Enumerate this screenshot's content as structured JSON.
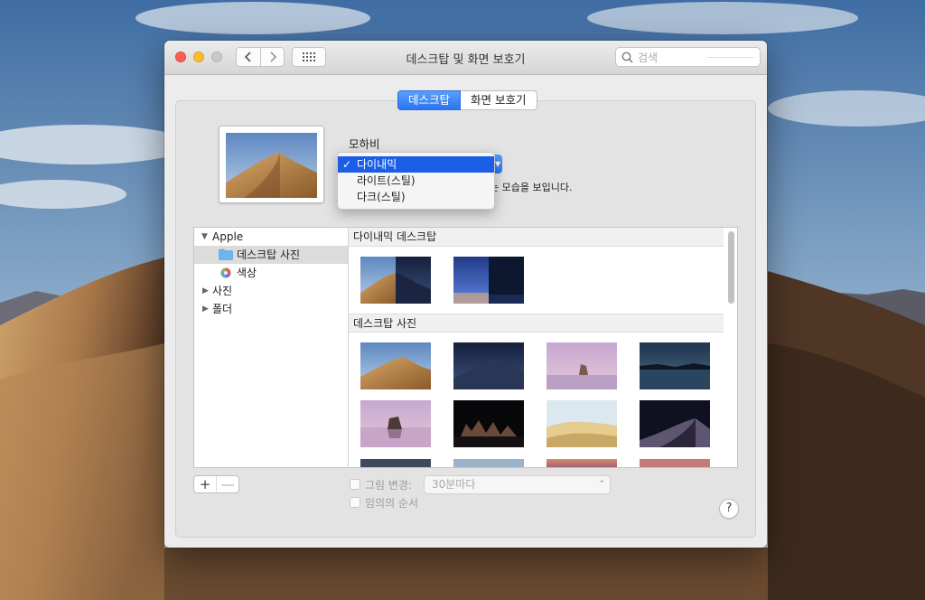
{
  "window": {
    "title": "데스크탑 및 화면 보호기",
    "search_placeholder": "검색"
  },
  "tabs": [
    {
      "label": "데스크탑",
      "active": true
    },
    {
      "label": "화면 보호기",
      "active": false
    }
  ],
  "wallpaper": {
    "name": "모하비",
    "description_fragment": "는 모습을 보입니다."
  },
  "appearance_menu": {
    "items": [
      {
        "label": "다이내믹",
        "selected": true
      },
      {
        "label": "라이트(스틸)",
        "selected": false
      },
      {
        "label": "다크(스틸)",
        "selected": false
      }
    ]
  },
  "sidebar": {
    "items": [
      {
        "label": "Apple",
        "expanded": true
      },
      {
        "label": "데스크탑 사진",
        "selected": true
      },
      {
        "label": "색상"
      },
      {
        "label": "사진",
        "expanded": false
      },
      {
        "label": "폴더",
        "expanded": false
      }
    ]
  },
  "sections": [
    {
      "title": "다이내믹 데스크탑"
    },
    {
      "title": "데스크탑 사진"
    }
  ],
  "options": {
    "change_picture_label": "그림 변경:",
    "change_picture_checked": false,
    "interval_value": "30분마다",
    "random_order_label": "임의의 순서",
    "random_order_checked": false
  },
  "buttons": {
    "add": "+",
    "remove": "—",
    "help": "?"
  },
  "colors": {
    "accent": "#2a74f0",
    "menu_highlight": "#1a5ee5",
    "close": "#fc5f57",
    "minimize": "#fdbc2e"
  }
}
